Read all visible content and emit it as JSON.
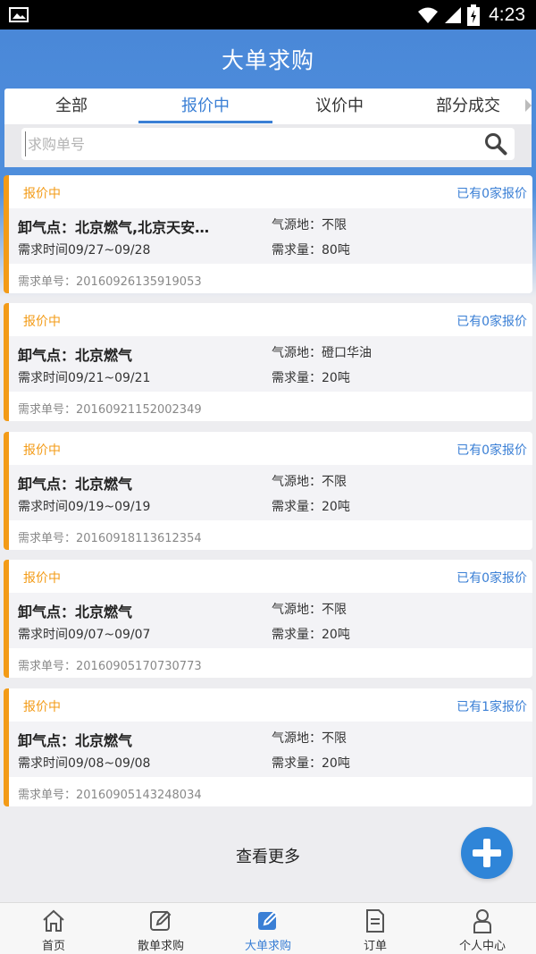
{
  "status_bar": {
    "time": "4:23"
  },
  "header": {
    "title": "大单求购"
  },
  "tabs": [
    {
      "label": "全部",
      "active": false
    },
    {
      "label": "报价中",
      "active": true
    },
    {
      "label": "议价中",
      "active": false
    },
    {
      "label": "部分成交",
      "active": false
    }
  ],
  "search": {
    "placeholder": "求购单号",
    "value": ""
  },
  "cards": [
    {
      "status": "报价中",
      "quotes": "已有0家报价",
      "unload": "卸气点：北京燃气,北京天安…",
      "source": "气源地：不限",
      "time": "需求时间09/27~09/28",
      "qty": "需求量：80吨",
      "order_no": "需求单号：20160926135919053"
    },
    {
      "status": "报价中",
      "quotes": "已有0家报价",
      "unload": "卸气点：北京燃气",
      "source": "气源地：磴口华油",
      "time": "需求时间09/21~09/21",
      "qty": "需求量：20吨",
      "order_no": "需求单号：20160921152002349"
    },
    {
      "status": "报价中",
      "quotes": "已有0家报价",
      "unload": "卸气点：北京燃气",
      "source": "气源地：不限",
      "time": "需求时间09/19~09/19",
      "qty": "需求量：20吨",
      "order_no": "需求单号：20160918113612354"
    },
    {
      "status": "报价中",
      "quotes": "已有0家报价",
      "unload": "卸气点：北京燃气",
      "source": "气源地：不限",
      "time": "需求时间09/07~09/07",
      "qty": "需求量：20吨",
      "order_no": "需求单号：20160905170730773"
    },
    {
      "status": "报价中",
      "quotes": "已有1家报价",
      "unload": "卸气点：北京燃气",
      "source": "气源地：不限",
      "time": "需求时间09/08~09/08",
      "qty": "需求量：20吨",
      "order_no": "需求单号：20160905143248034"
    }
  ],
  "more_label": "查看更多",
  "bottom_nav": [
    {
      "label": "首页",
      "icon": "home-icon",
      "active": false
    },
    {
      "label": "散单求购",
      "icon": "edit-icon",
      "active": false
    },
    {
      "label": "大单求购",
      "icon": "edit-icon",
      "active": true
    },
    {
      "label": "订单",
      "icon": "document-icon",
      "active": false
    },
    {
      "label": "个人中心",
      "icon": "person-icon",
      "active": false
    }
  ],
  "colors": {
    "primary": "#3a7fd5",
    "accent": "#f39b17",
    "header": "#4a88d8"
  }
}
